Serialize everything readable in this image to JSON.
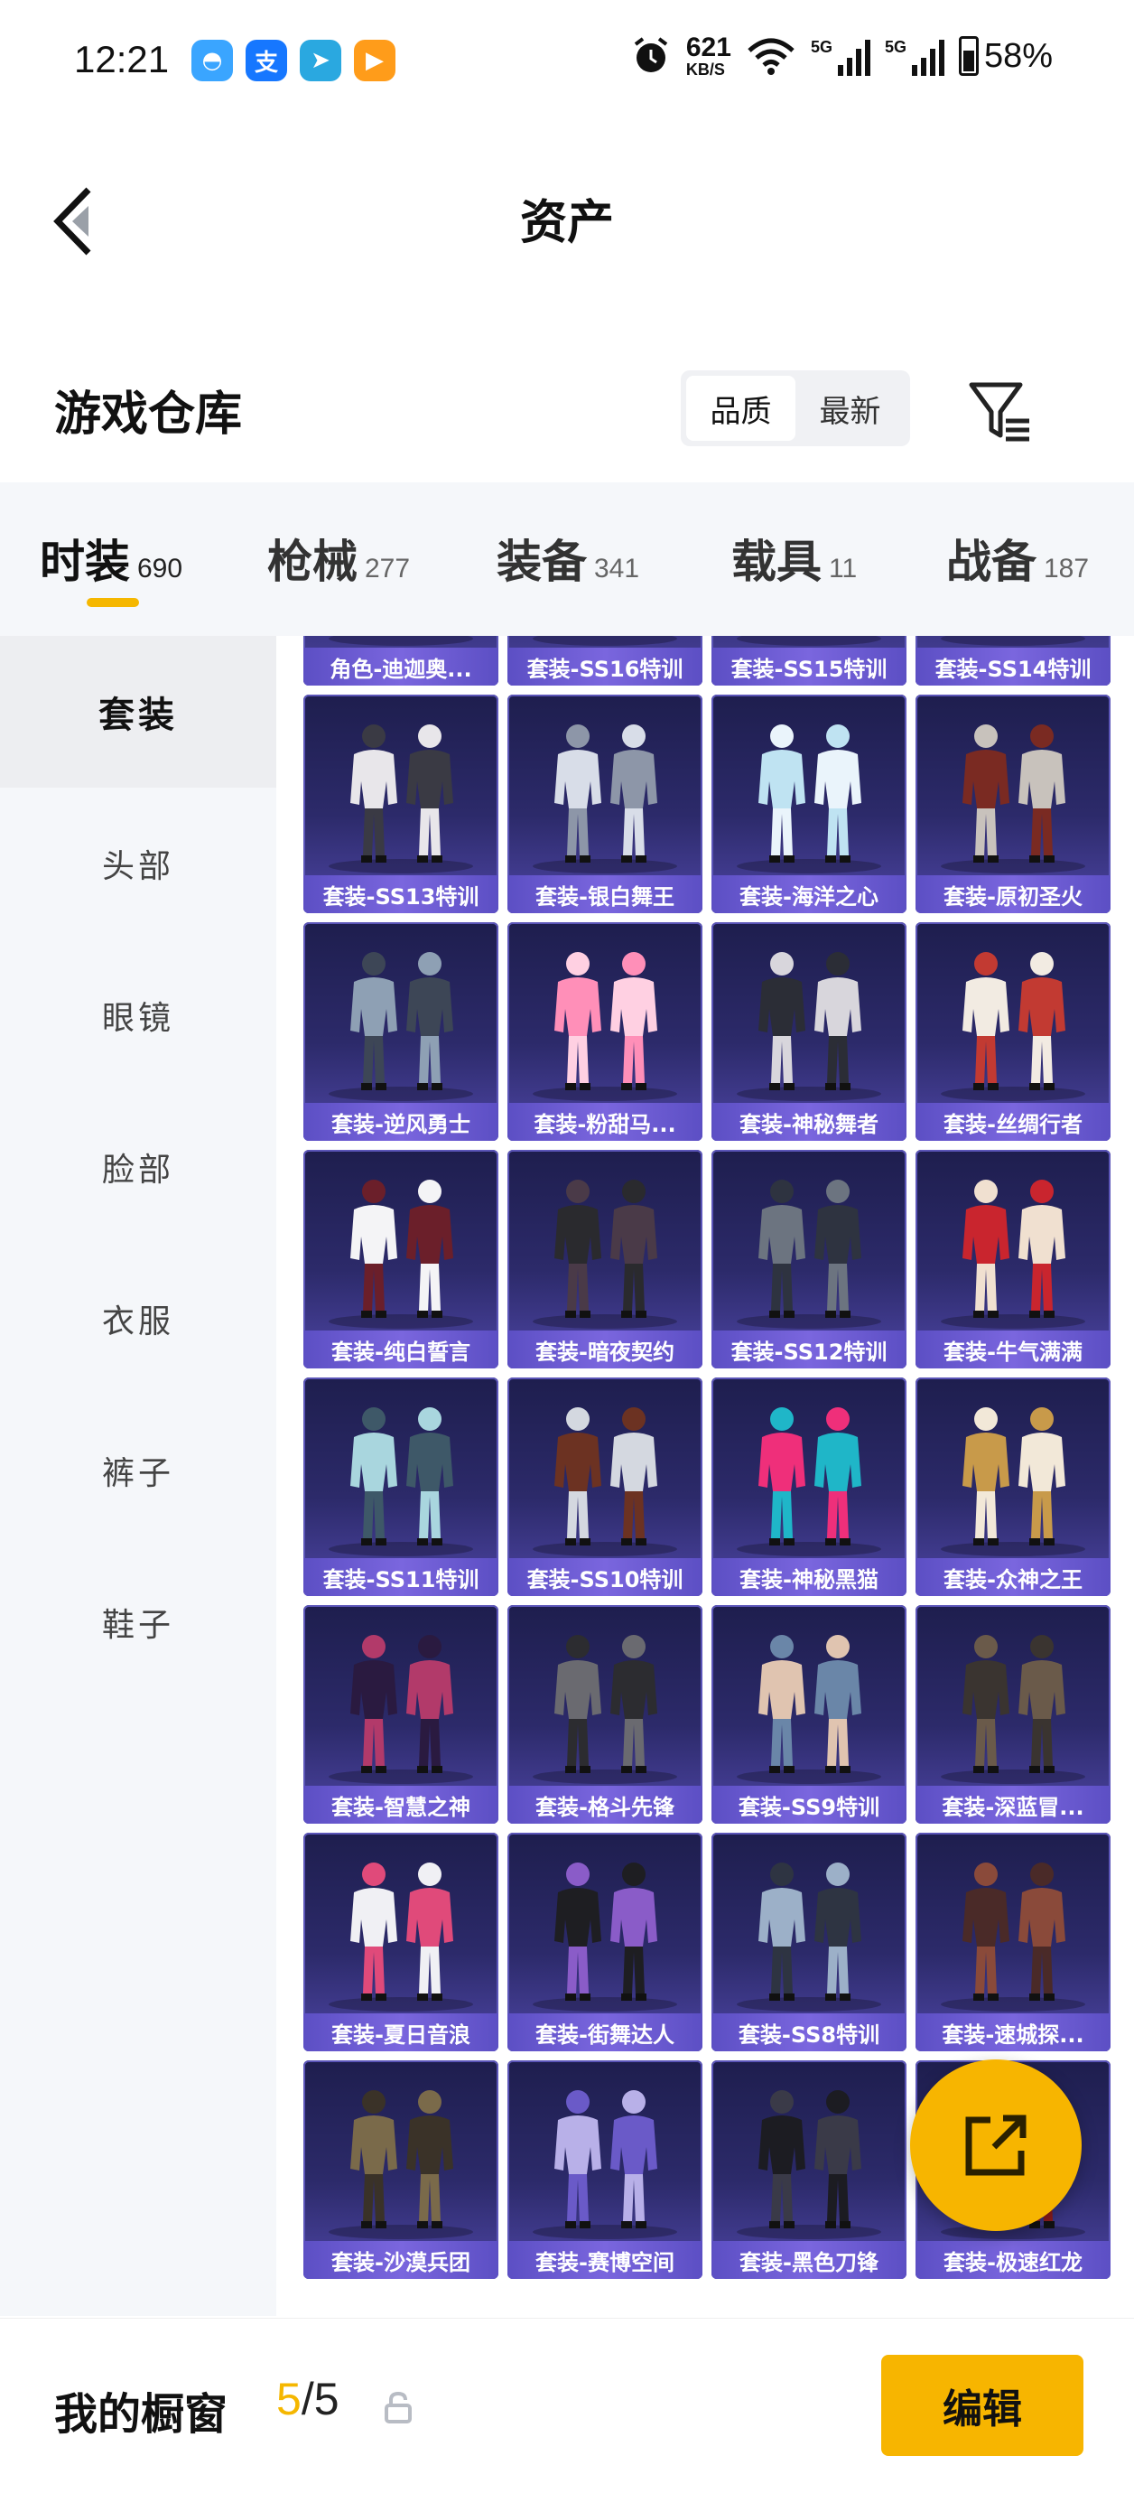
{
  "status_bar": {
    "time": "12:21",
    "apps": [
      {
        "name": "qq-browser-icon",
        "glyph": "◓",
        "color": "#3aa5ff"
      },
      {
        "name": "alipay-icon",
        "glyph": "支",
        "color": "#1677ff"
      },
      {
        "name": "telegram-icon",
        "glyph": "➤",
        "color": "#2aa8e0"
      },
      {
        "name": "video-app-icon",
        "glyph": "▶",
        "color": "#ff9c1a"
      }
    ],
    "net_speed_value": "621",
    "net_speed_unit": "KB/S",
    "signal1_tag": "5G",
    "signal2_tag": "5G",
    "battery": "58%"
  },
  "nav": {
    "title": "资产"
  },
  "warehouse": {
    "title": "游戏仓库",
    "sort_options": [
      "品质",
      "最新"
    ],
    "active_sort": 0
  },
  "category_tabs": [
    {
      "label": "时装",
      "count": "690",
      "active": true
    },
    {
      "label": "枪械",
      "count": "277"
    },
    {
      "label": "装备",
      "count": "341"
    },
    {
      "label": "载具",
      "count": "11"
    },
    {
      "label": "战备",
      "count": "187"
    }
  ],
  "sidebar": [
    {
      "label": "套装",
      "active": true
    },
    {
      "label": "头部"
    },
    {
      "label": "眼镜"
    },
    {
      "label": "脸部"
    },
    {
      "label": "衣服"
    },
    {
      "label": "裤子"
    },
    {
      "label": "鞋子"
    }
  ],
  "items": [
    "角色-迪迦奥...",
    "套装-SS16特训",
    "套装-SS15特训",
    "套装-SS14特训",
    "套装-SS13特训",
    "套装-银白舞王",
    "套装-海洋之心",
    "套装-原初圣火",
    "套装-逆风勇士",
    "套装-粉甜马...",
    "套装-神秘舞者",
    "套装-丝绸行者",
    "套装-纯白誓言",
    "套装-暗夜契约",
    "套装-SS12特训",
    "套装-牛气满满",
    "套装-SS11特训",
    "套装-SS10特训",
    "套装-神秘黑猫",
    "套装-众神之王",
    "套装-智慧之神",
    "套装-格斗先锋",
    "套装-SS9特训",
    "套装-深蓝冒...",
    "套装-夏日音浪",
    "套装-街舞达人",
    "套装-SS8特训",
    "套装-速城探...",
    "套装-沙漠兵团",
    "套装-赛博空间",
    "套装-黑色刀锋",
    "套装-极速红龙"
  ],
  "item_colors": [
    [
      "#cfc6c0",
      "#6e5a4c"
    ],
    [
      "#3c3a4a",
      "#8b8796"
    ],
    [
      "#2a2a38",
      "#6a6a7a"
    ],
    [
      "#3a2f2a",
      "#8a7a6a"
    ],
    [
      "#e8e6ea",
      "#3a3a44"
    ],
    [
      "#d8dde8",
      "#8d96a8"
    ],
    [
      "#bfe3f2",
      "#eaf4fb"
    ],
    [
      "#7a2a22",
      "#c8c2bc"
    ],
    [
      "#8ea0b4",
      "#3d4656"
    ],
    [
      "#ff8fb8",
      "#ffd0e2"
    ],
    [
      "#2b2d36",
      "#d8d6dc"
    ],
    [
      "#f2ebe2",
      "#c23a32"
    ],
    [
      "#f4f4f6",
      "#6b1f2a"
    ],
    [
      "#2a2a2e",
      "#4a3a48"
    ],
    [
      "#6c7480",
      "#2e3340"
    ],
    [
      "#c9252e",
      "#f0e0d0"
    ],
    [
      "#a9d6de",
      "#3e5868"
    ],
    [
      "#6c3222",
      "#d4d8e0"
    ],
    [
      "#ef2f7a",
      "#1fb6c8"
    ],
    [
      "#c89a4a",
      "#f2e8d8"
    ],
    [
      "#2a1a40",
      "#b23a6a"
    ],
    [
      "#6a6a70",
      "#2c2c30"
    ],
    [
      "#e0c4b0",
      "#6a86a8"
    ],
    [
      "#3a3430",
      "#6a5a4a"
    ],
    [
      "#f0f0f4",
      "#e04a7a"
    ],
    [
      "#1e1e22",
      "#8a5cc8"
    ],
    [
      "#9cb0c8",
      "#2e3442"
    ],
    [
      "#4a2a28",
      "#8a4a3a"
    ],
    [
      "#7a6a4a",
      "#3a3228"
    ],
    [
      "#b8b0e8",
      "#6a5ac8"
    ],
    [
      "#1c1c22",
      "#3a3a48"
    ],
    [
      "#8a1c1c",
      "#2a2a2e"
    ]
  ],
  "bottom_bar": {
    "label": "我的橱窗",
    "current": "5",
    "separator": "/",
    "max": "5",
    "edit_label": "编辑"
  },
  "accent_color": "#f7b500"
}
